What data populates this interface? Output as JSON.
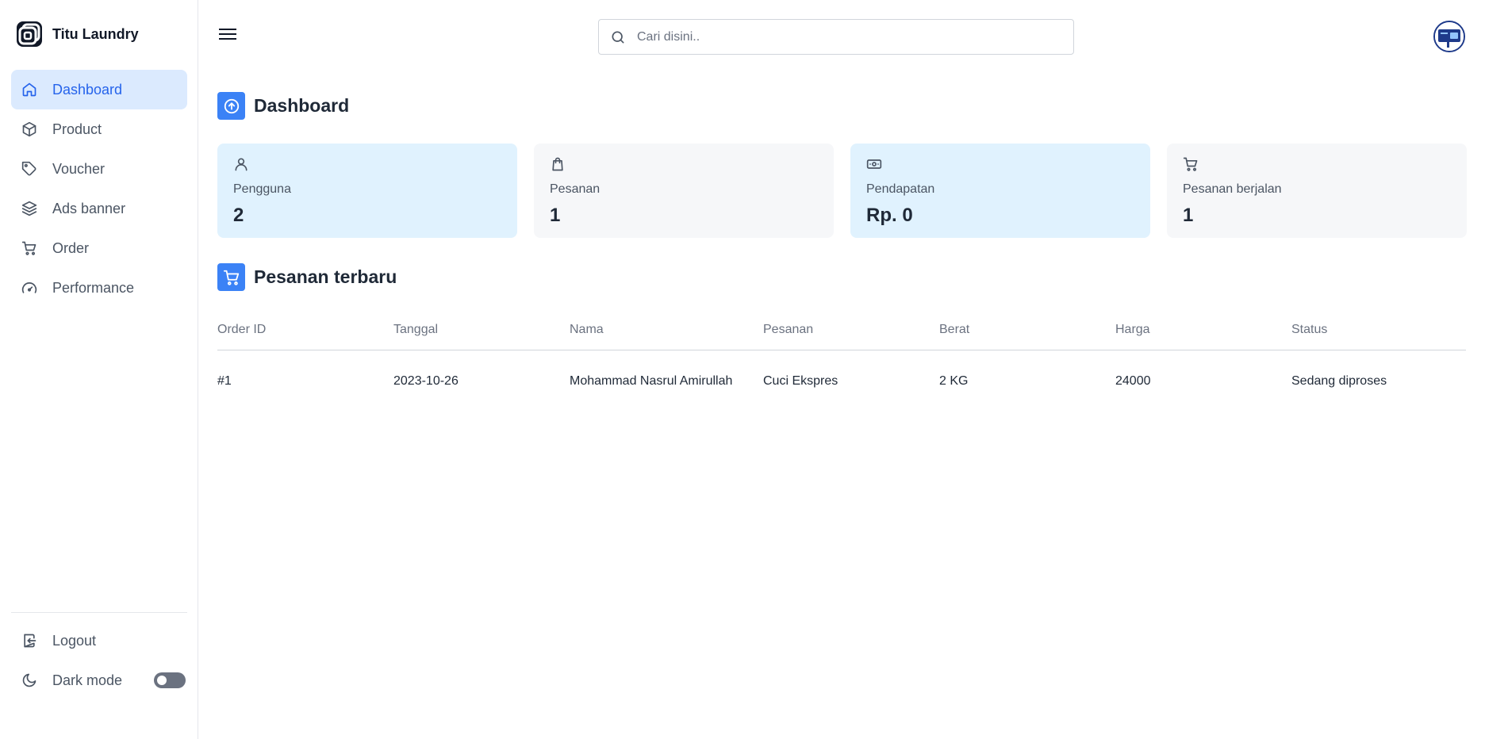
{
  "app": {
    "name": "Titu Laundry"
  },
  "sidebar": {
    "items": [
      {
        "label": "Dashboard",
        "icon": "home-icon",
        "active": true
      },
      {
        "label": "Product",
        "icon": "box-icon",
        "active": false
      },
      {
        "label": "Voucher",
        "icon": "tag-icon",
        "active": false
      },
      {
        "label": "Ads banner",
        "icon": "layers-icon",
        "active": false
      },
      {
        "label": "Order",
        "icon": "cart-icon",
        "active": false
      },
      {
        "label": "Performance",
        "icon": "gauge-icon",
        "active": false
      }
    ],
    "logout_label": "Logout",
    "dark_mode_label": "Dark mode",
    "dark_mode_on": false
  },
  "header": {
    "search_placeholder": "Cari disini.."
  },
  "dashboard": {
    "title": "Dashboard",
    "stats": [
      {
        "label": "Pengguna",
        "value": "2",
        "icon": "user-icon"
      },
      {
        "label": "Pesanan",
        "value": "1",
        "icon": "shopping-bag-icon"
      },
      {
        "label": "Pendapatan",
        "value": "Rp. 0",
        "icon": "money-icon"
      },
      {
        "label": "Pesanan berjalan",
        "value": "1",
        "icon": "cart-icon"
      }
    ]
  },
  "orders": {
    "title": "Pesanan terbaru",
    "columns": [
      "Order ID",
      "Tanggal",
      "Nama",
      "Pesanan",
      "Berat",
      "Harga",
      "Status"
    ],
    "rows": [
      [
        "#1",
        "2023-10-26",
        "Mohammad Nasrul Amirullah",
        "Cuci Ekspres",
        "2 KG",
        "24000",
        "Sedang diproses"
      ]
    ]
  },
  "colors": {
    "accent": "#3b82f6",
    "active_nav_bg": "#dbeafe",
    "card_blue": "#e0f2fe",
    "card_gray": "#f6f7f9"
  }
}
